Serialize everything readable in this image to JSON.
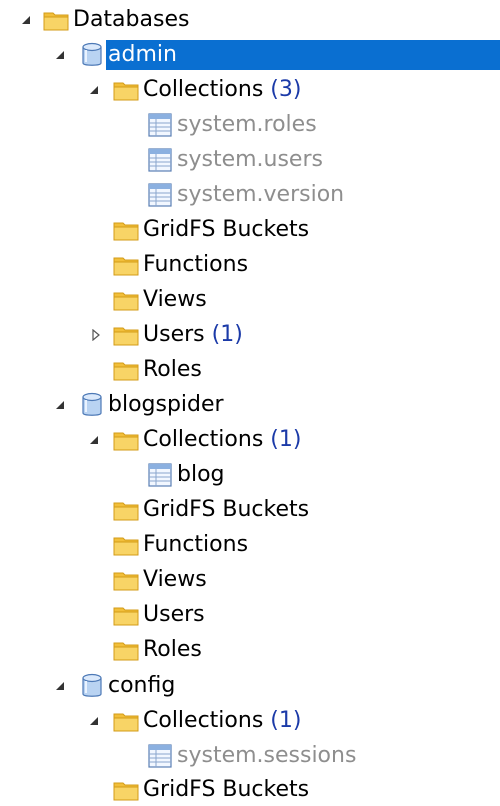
{
  "tree": {
    "root_label": "Databases",
    "databases": [
      {
        "name": "admin",
        "collections_label": "Collections",
        "collections_count": "(3)",
        "collections": [
          "system.roles",
          "system.users",
          "system.version"
        ],
        "folders": {
          "gridfs": "GridFS Buckets",
          "functions": "Functions",
          "views": "Views",
          "users": "Users",
          "users_count": "(1)",
          "roles": "Roles"
        }
      },
      {
        "name": "blogspider",
        "collections_label": "Collections",
        "collections_count": "(1)",
        "collections": [
          "blog"
        ],
        "folders": {
          "gridfs": "GridFS Buckets",
          "functions": "Functions",
          "views": "Views",
          "users": "Users",
          "roles": "Roles"
        }
      },
      {
        "name": "config",
        "collections_label": "Collections",
        "collections_count": "(1)",
        "collections": [
          "system.sessions"
        ],
        "folders": {
          "gridfs": "GridFS Buckets"
        }
      }
    ]
  },
  "icons": {
    "expanded_arrow": "expanded-arrow-icon",
    "collapsed_arrow": "collapsed-arrow-icon",
    "folder": "folder-icon",
    "database": "database-icon",
    "collection": "collection-table-icon"
  },
  "colors": {
    "selection": "#0a6fd1",
    "count": "#1b3aa8",
    "dim_text": "#8e8e8e",
    "folder": "#f5c84b"
  }
}
